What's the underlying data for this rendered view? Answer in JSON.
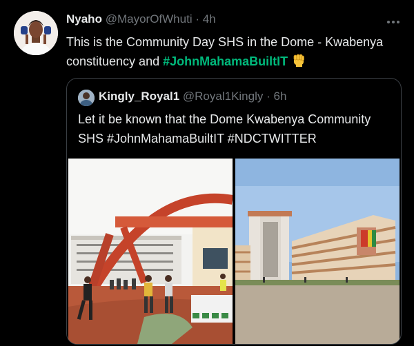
{
  "tweet": {
    "author_name": "Nyaho",
    "author_handle": "@MayorOfWhuti",
    "separator": "·",
    "time": "4h",
    "more_icon": "more-dots-icon",
    "text_part1": "This is the Community Day SHS in the Dome - Kwabenya constituency and ",
    "hashtag": "#JohnMahamaBuiltIT",
    "emoji_icon": "raised-fist-icon"
  },
  "quoted": {
    "author_name": "Kingly_Royal1",
    "author_handle": "@Royal1Kingly",
    "separator": "·",
    "time": "6h",
    "text": "Let it be known that the Dome Kwabenya Community SHS #JohnMahamaBuiltIT #NDCTWITTER",
    "photos": [
      "school-gate-photo",
      "school-building-photo"
    ]
  },
  "colors": {
    "background": "#000000",
    "text": "#e7e9ea",
    "muted": "#71767b",
    "hashtag": "#00ba7c",
    "border": "#3a3f44"
  }
}
